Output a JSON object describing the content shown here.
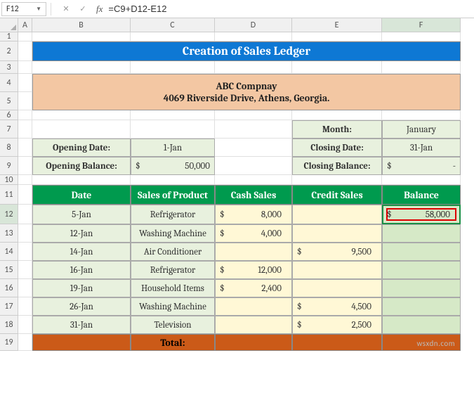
{
  "active_cell": "F12",
  "formula": "=C9+D12-E12",
  "col_labels": [
    "A",
    "B",
    "C",
    "D",
    "E",
    "F"
  ],
  "row_labels": [
    "1",
    "2",
    "3",
    "4",
    "5",
    "6",
    "7",
    "8",
    "9",
    "10",
    "11",
    "12",
    "13",
    "14",
    "15",
    "16",
    "17",
    "18",
    "19"
  ],
  "title": "Creation of Sales Ledger",
  "company": {
    "name": "ABC Compnay",
    "addr": "4069 Riverside Drive, Athens, Georgia."
  },
  "opening": {
    "date_label": "Opening Date:",
    "date_val": "1-Jan",
    "bal_label": "Opening Balance:",
    "bal_val": "50,000",
    "bal_sym": "$"
  },
  "closing": {
    "month_label": "Month:",
    "month_val": "January",
    "date_label": "Closing Date:",
    "date_val": "31-Jan",
    "bal_label": "Closing Balance:",
    "bal_sym": "$",
    "bal_val": "-"
  },
  "headers": {
    "date": "Date",
    "product": "Sales of Product",
    "cash": "Cash Sales",
    "credit": "Credit Sales",
    "balance": "Balance"
  },
  "rows": [
    {
      "date": "5-Jan",
      "product": "Refrigerator",
      "cash": "8,000",
      "credit": "",
      "balance": "58,000"
    },
    {
      "date": "12-Jan",
      "product": "Washing Machine",
      "cash": "4,000",
      "credit": "",
      "balance": ""
    },
    {
      "date": "14-Jan",
      "product": "Air Conditioner",
      "cash": "",
      "credit": "9,500",
      "balance": ""
    },
    {
      "date": "16-Jan",
      "product": "Refrigerator",
      "cash": "12,000",
      "credit": "",
      "balance": ""
    },
    {
      "date": "19-Jan",
      "product": "Household Items",
      "cash": "2,400",
      "credit": "",
      "balance": ""
    },
    {
      "date": "26-Jan",
      "product": "Washing Machine",
      "cash": "",
      "credit": "4,500",
      "balance": ""
    },
    {
      "date": "31-Jan",
      "product": "Television",
      "cash": "",
      "credit": "2,500",
      "balance": ""
    }
  ],
  "total_label": "Total:",
  "currency": "$",
  "watermark": "wsxdn.com"
}
